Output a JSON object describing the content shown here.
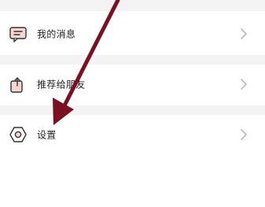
{
  "settings_list": {
    "items": [
      {
        "label": "我的消息",
        "icon": "message-icon"
      },
      {
        "label": "推荐给朋友",
        "icon": "share-icon"
      },
      {
        "label": "设置",
        "icon": "settings-icon"
      }
    ],
    "chevron_icon": "chevron-right-icon"
  },
  "overlay": {
    "annotation": "arrow-pointer",
    "arrow_color": "#7a1022"
  },
  "colors": {
    "background": "#ffffff",
    "separator": "#f3f3f3",
    "text": "#222222",
    "chevron": "#bbbbbb",
    "icon_stroke": "#333333",
    "icon_accent": "#e9a7a0"
  }
}
